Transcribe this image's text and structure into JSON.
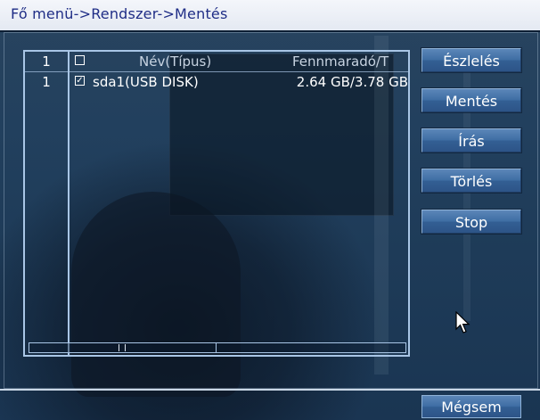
{
  "title_bar": {
    "breadcrumb": "Fő menü->Rendszer->Mentés"
  },
  "device_table": {
    "columns": {
      "index": "1",
      "name_type": "Név(Típus)",
      "remaining_total": "Fennmaradó/T"
    },
    "header_checkbox_checked": false,
    "rows": [
      {
        "index": "1",
        "checked": true,
        "name_type": "sda1(USB DISK)",
        "remaining_total": "2.64 GB/3.78 GB"
      }
    ],
    "hscroll_position": 0.0
  },
  "actions": {
    "detect": "Észlelés",
    "backup": "Mentés",
    "write": "Írás",
    "delete": "Törlés",
    "stop": "Stop"
  },
  "footer": {
    "cancel": "Mégsem"
  },
  "colors": {
    "title_text": "#1f2d86",
    "table_border": "#a9c6e6",
    "button_fill": "#3f6ea4"
  },
  "icons": {
    "cursor": "mouse-pointer-icon",
    "checkbox": "checkbox-icon"
  }
}
